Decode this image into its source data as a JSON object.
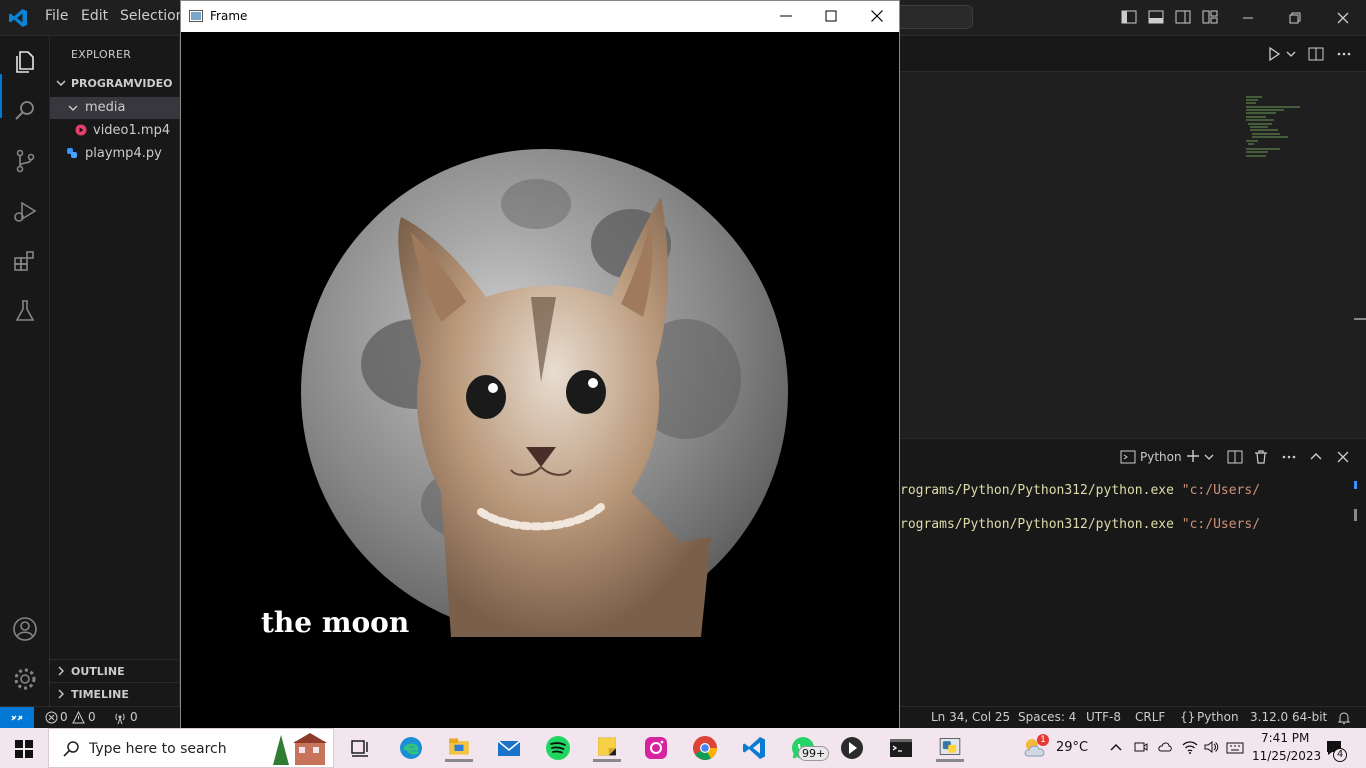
{
  "titlebar": {
    "menu": [
      "File",
      "Edit",
      "Selection"
    ]
  },
  "sidebar": {
    "title": "EXPLORER",
    "root": "PROGRAMVIDEO",
    "tree": [
      {
        "label": "media"
      },
      {
        "label": "video1.mp4"
      },
      {
        "label": "playmp4.py"
      }
    ],
    "outline": "OUTLINE",
    "timeline": "TIMELINE"
  },
  "panel": {
    "terminal_kind": "Python",
    "lines": [
      {
        "cmd": "rograms/Python/Python312/python.exe ",
        "path": "\"c:/Users/"
      },
      {
        "cmd": "rograms/Python/Python312/python.exe ",
        "path": "\"c:/Users/"
      }
    ]
  },
  "statusbar": {
    "errors": "0",
    "warnings": "0",
    "ports": "0",
    "position": "Ln 34, Col 25",
    "spaces": "Spaces: 4",
    "encoding": "UTF-8",
    "eol": "CRLF",
    "language": "Python",
    "interpreter": "3.12.0 64-bit"
  },
  "frame": {
    "title": "Frame",
    "caption": "the moon"
  },
  "taskbar": {
    "search_placeholder": "Type here to search",
    "whatsapp_badge": "99+",
    "weather": "29°C",
    "weather_badge": "1",
    "time": "7:41 PM",
    "date": "11/25/2023",
    "notifications": "4"
  },
  "colors": {
    "accent": "#0078d4",
    "terminal_cmd": "#dcdcaa",
    "terminal_string": "#ce9178",
    "python_file": "#3794ff",
    "video_file": "#e83e6c"
  }
}
